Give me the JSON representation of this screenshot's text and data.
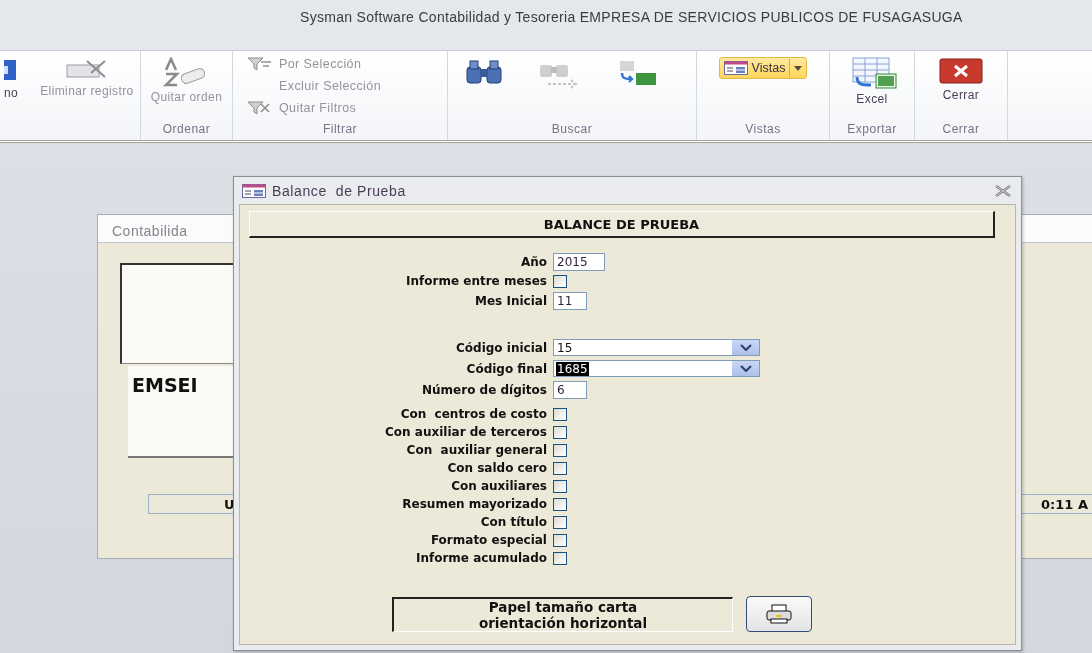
{
  "app_title": "Sysman Software Contabilidad y Tesoreria EMPRESA DE SERVICIOS PUBLICOS DE FUSAGASUGA",
  "ribbon": {
    "leading": [
      {
        "kind": "large",
        "label": "no",
        "disabled": false
      },
      {
        "kind": "large",
        "label": "Eliminar registro",
        "disabled": true
      }
    ],
    "groups": [
      {
        "label": "Ordenar",
        "buttons": [
          {
            "kind": "large",
            "label": "Quitar orden",
            "disabled": true
          }
        ]
      },
      {
        "label": "Filtrar",
        "buttons": [
          {
            "kind": "small",
            "label": "Por Selección",
            "disabled": true
          },
          {
            "kind": "small",
            "label": "Excluir Selección",
            "disabled": true
          },
          {
            "kind": "small",
            "label": "Quitar Filtros",
            "disabled": true
          }
        ]
      },
      {
        "label": "Buscar",
        "buttons": [
          {
            "kind": "icon",
            "disabled": false
          },
          {
            "kind": "icon",
            "disabled": true
          },
          {
            "kind": "icon",
            "disabled": false
          }
        ]
      },
      {
        "label": "Vistas",
        "buttons": [
          {
            "kind": "split",
            "label": "Vistas",
            "disabled": false
          }
        ]
      },
      {
        "label": "Exportar",
        "buttons": [
          {
            "kind": "large",
            "label": "Excel",
            "disabled": false
          }
        ]
      },
      {
        "label": "Cerrar",
        "buttons": [
          {
            "kind": "large",
            "label": "Cerrar",
            "disabled": false
          }
        ]
      }
    ]
  },
  "background_window": {
    "title": "Contabilida",
    "company": "EMSEI",
    "status_left": "U",
    "status_right": "0:11 A"
  },
  "dialog": {
    "title": "Balance  de Prueba",
    "header": "BALANCE DE PRUEBA",
    "field_groups": [
      [
        {
          "kind": "text",
          "label": "Año",
          "value": "2015"
        },
        {
          "kind": "checkbox",
          "label": "Informe entre meses",
          "checked": false
        },
        {
          "kind": "text",
          "label": "Mes Inicial",
          "value": "11"
        }
      ],
      [
        {
          "kind": "combo",
          "label": "Código inicial",
          "value": "15",
          "selected": false
        },
        {
          "kind": "combo",
          "label": "Código final",
          "value": "1685",
          "selected": true
        },
        {
          "kind": "text",
          "label": "Número de dígitos",
          "value": "6"
        }
      ],
      [
        {
          "kind": "checkbox",
          "label": "Con  centros de costo",
          "checked": false
        },
        {
          "kind": "checkbox",
          "label": "Con auxiliar de terceros",
          "checked": false
        },
        {
          "kind": "checkbox",
          "label": "Con  auxiliar general",
          "checked": false
        },
        {
          "kind": "checkbox",
          "label": "Con saldo cero",
          "checked": false
        },
        {
          "kind": "checkbox",
          "label": "Con auxiliares",
          "checked": false
        },
        {
          "kind": "checkbox",
          "label": "Resumen mayorizado",
          "checked": false
        },
        {
          "kind": "checkbox",
          "label": "Con título",
          "checked": false
        },
        {
          "kind": "checkbox",
          "label": "Formato especial",
          "checked": false
        },
        {
          "kind": "checkbox",
          "label": "Informe acumulado",
          "checked": false
        }
      ]
    ],
    "paper_note": [
      "Papel tamaño carta",
      "orientación horizontal"
    ]
  }
}
